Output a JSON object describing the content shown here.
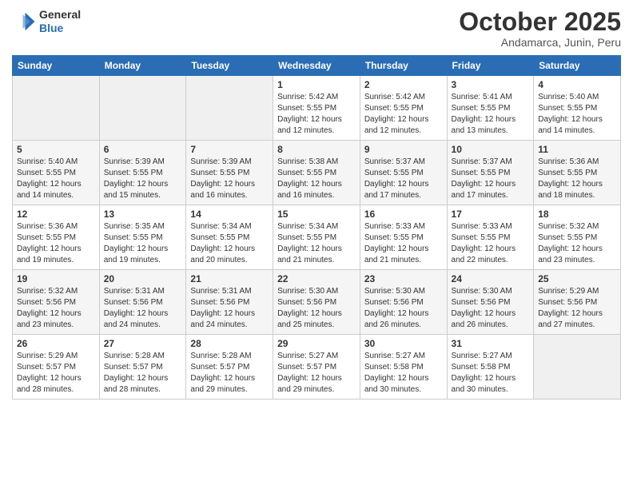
{
  "logo": {
    "line1": "General",
    "line2": "Blue"
  },
  "header": {
    "month": "October 2025",
    "location": "Andamarca, Junin, Peru"
  },
  "weekdays": [
    "Sunday",
    "Monday",
    "Tuesday",
    "Wednesday",
    "Thursday",
    "Friday",
    "Saturday"
  ],
  "weeks": [
    [
      {
        "day": "",
        "info": ""
      },
      {
        "day": "",
        "info": ""
      },
      {
        "day": "",
        "info": ""
      },
      {
        "day": "1",
        "info": "Sunrise: 5:42 AM\nSunset: 5:55 PM\nDaylight: 12 hours\nand 12 minutes."
      },
      {
        "day": "2",
        "info": "Sunrise: 5:42 AM\nSunset: 5:55 PM\nDaylight: 12 hours\nand 12 minutes."
      },
      {
        "day": "3",
        "info": "Sunrise: 5:41 AM\nSunset: 5:55 PM\nDaylight: 12 hours\nand 13 minutes."
      },
      {
        "day": "4",
        "info": "Sunrise: 5:40 AM\nSunset: 5:55 PM\nDaylight: 12 hours\nand 14 minutes."
      }
    ],
    [
      {
        "day": "5",
        "info": "Sunrise: 5:40 AM\nSunset: 5:55 PM\nDaylight: 12 hours\nand 14 minutes."
      },
      {
        "day": "6",
        "info": "Sunrise: 5:39 AM\nSunset: 5:55 PM\nDaylight: 12 hours\nand 15 minutes."
      },
      {
        "day": "7",
        "info": "Sunrise: 5:39 AM\nSunset: 5:55 PM\nDaylight: 12 hours\nand 16 minutes."
      },
      {
        "day": "8",
        "info": "Sunrise: 5:38 AM\nSunset: 5:55 PM\nDaylight: 12 hours\nand 16 minutes."
      },
      {
        "day": "9",
        "info": "Sunrise: 5:37 AM\nSunset: 5:55 PM\nDaylight: 12 hours\nand 17 minutes."
      },
      {
        "day": "10",
        "info": "Sunrise: 5:37 AM\nSunset: 5:55 PM\nDaylight: 12 hours\nand 17 minutes."
      },
      {
        "day": "11",
        "info": "Sunrise: 5:36 AM\nSunset: 5:55 PM\nDaylight: 12 hours\nand 18 minutes."
      }
    ],
    [
      {
        "day": "12",
        "info": "Sunrise: 5:36 AM\nSunset: 5:55 PM\nDaylight: 12 hours\nand 19 minutes."
      },
      {
        "day": "13",
        "info": "Sunrise: 5:35 AM\nSunset: 5:55 PM\nDaylight: 12 hours\nand 19 minutes."
      },
      {
        "day": "14",
        "info": "Sunrise: 5:34 AM\nSunset: 5:55 PM\nDaylight: 12 hours\nand 20 minutes."
      },
      {
        "day": "15",
        "info": "Sunrise: 5:34 AM\nSunset: 5:55 PM\nDaylight: 12 hours\nand 21 minutes."
      },
      {
        "day": "16",
        "info": "Sunrise: 5:33 AM\nSunset: 5:55 PM\nDaylight: 12 hours\nand 21 minutes."
      },
      {
        "day": "17",
        "info": "Sunrise: 5:33 AM\nSunset: 5:55 PM\nDaylight: 12 hours\nand 22 minutes."
      },
      {
        "day": "18",
        "info": "Sunrise: 5:32 AM\nSunset: 5:55 PM\nDaylight: 12 hours\nand 23 minutes."
      }
    ],
    [
      {
        "day": "19",
        "info": "Sunrise: 5:32 AM\nSunset: 5:56 PM\nDaylight: 12 hours\nand 23 minutes."
      },
      {
        "day": "20",
        "info": "Sunrise: 5:31 AM\nSunset: 5:56 PM\nDaylight: 12 hours\nand 24 minutes."
      },
      {
        "day": "21",
        "info": "Sunrise: 5:31 AM\nSunset: 5:56 PM\nDaylight: 12 hours\nand 24 minutes."
      },
      {
        "day": "22",
        "info": "Sunrise: 5:30 AM\nSunset: 5:56 PM\nDaylight: 12 hours\nand 25 minutes."
      },
      {
        "day": "23",
        "info": "Sunrise: 5:30 AM\nSunset: 5:56 PM\nDaylight: 12 hours\nand 26 minutes."
      },
      {
        "day": "24",
        "info": "Sunrise: 5:30 AM\nSunset: 5:56 PM\nDaylight: 12 hours\nand 26 minutes."
      },
      {
        "day": "25",
        "info": "Sunrise: 5:29 AM\nSunset: 5:56 PM\nDaylight: 12 hours\nand 27 minutes."
      }
    ],
    [
      {
        "day": "26",
        "info": "Sunrise: 5:29 AM\nSunset: 5:57 PM\nDaylight: 12 hours\nand 28 minutes."
      },
      {
        "day": "27",
        "info": "Sunrise: 5:28 AM\nSunset: 5:57 PM\nDaylight: 12 hours\nand 28 minutes."
      },
      {
        "day": "28",
        "info": "Sunrise: 5:28 AM\nSunset: 5:57 PM\nDaylight: 12 hours\nand 29 minutes."
      },
      {
        "day": "29",
        "info": "Sunrise: 5:27 AM\nSunset: 5:57 PM\nDaylight: 12 hours\nand 29 minutes."
      },
      {
        "day": "30",
        "info": "Sunrise: 5:27 AM\nSunset: 5:58 PM\nDaylight: 12 hours\nand 30 minutes."
      },
      {
        "day": "31",
        "info": "Sunrise: 5:27 AM\nSunset: 5:58 PM\nDaylight: 12 hours\nand 30 minutes."
      },
      {
        "day": "",
        "info": ""
      }
    ]
  ]
}
